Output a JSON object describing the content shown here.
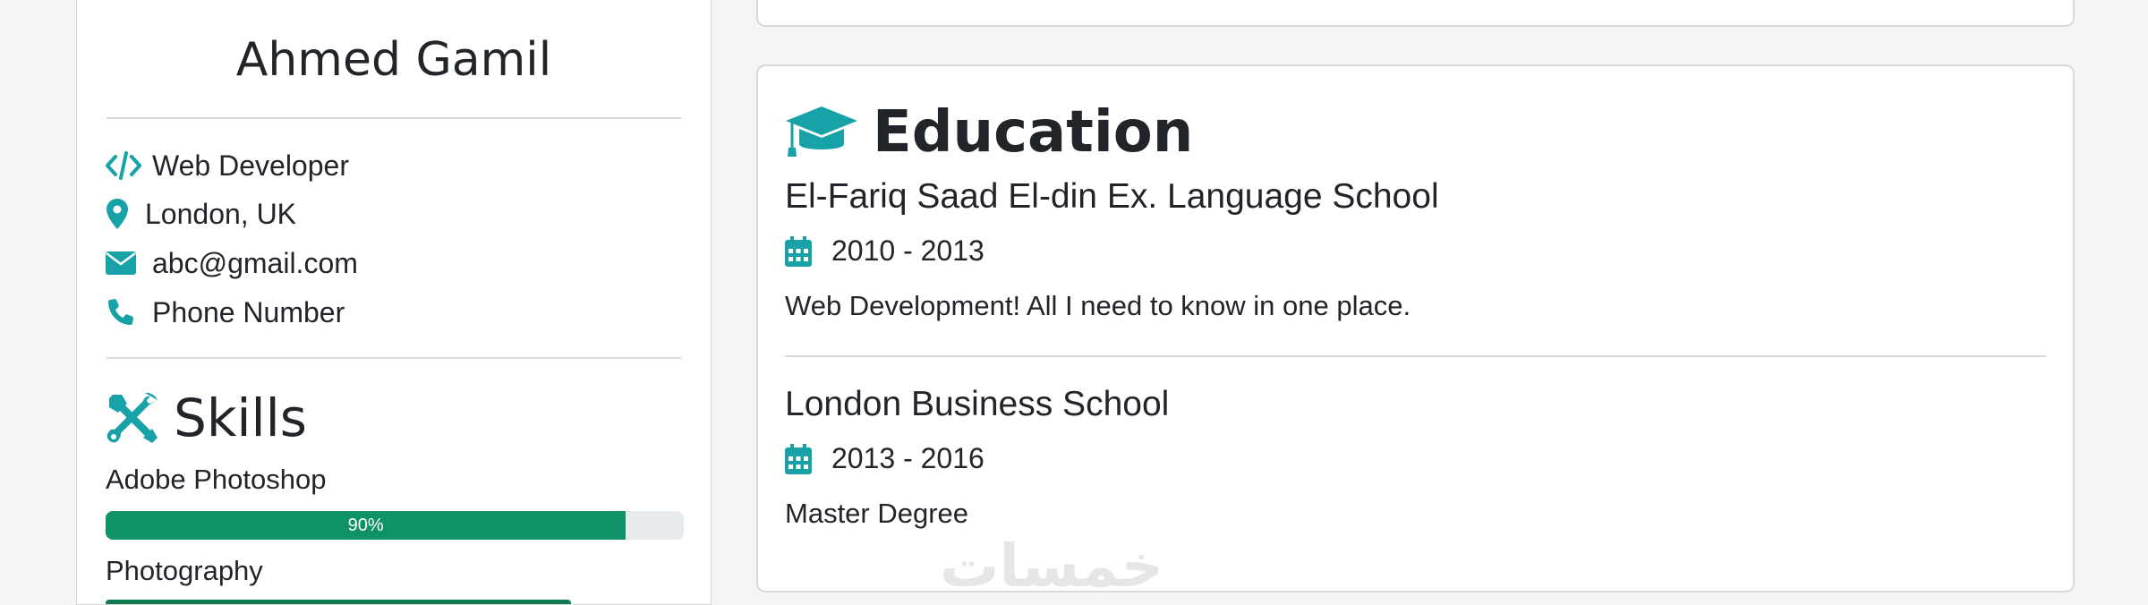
{
  "profile": {
    "name": "Ahmed Gamil",
    "job": "Web Developer",
    "location": "London, UK",
    "email": "abc@gmail.com",
    "phone": "Phone Number",
    "icons": [
      "code-icon",
      "map-marker-icon",
      "envelope-icon",
      "phone-icon"
    ]
  },
  "skills": {
    "title": "Skills",
    "items": [
      {
        "label": "Adobe Photoshop",
        "percent": 90,
        "percent_text": "90%"
      },
      {
        "label": "Photography"
      }
    ]
  },
  "education": {
    "title": "Education",
    "items": [
      {
        "school": "El-Fariq Saad El-din Ex. Language School",
        "years": "2010 - 2013",
        "description": "Web Development! All I need to know in one place."
      },
      {
        "school": "London Business School",
        "years": "2013 - 2016",
        "description": "Master Degree"
      }
    ]
  },
  "watermark": "خمسات",
  "colors": {
    "accent": "#17a2a8",
    "progress": "#0f9268"
  }
}
